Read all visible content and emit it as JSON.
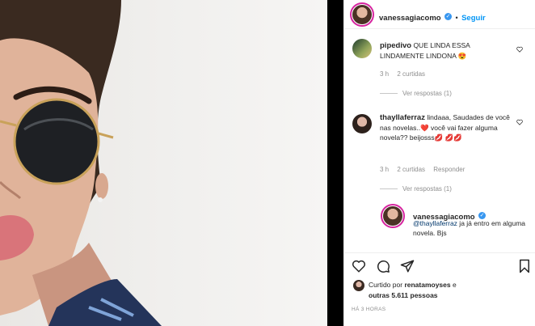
{
  "post": {
    "author": "vanessagiacomo",
    "follow_label": "Seguir",
    "dot": "•"
  },
  "comments": [
    {
      "user": "pipedivo",
      "text": "QUE LINDA ESSA LINDAMENTE LINDONA 😍",
      "time": "3 h",
      "likes": "2 curtidas",
      "replies": "Ver respostas (1)"
    },
    {
      "user": "thayllaferraz",
      "text": "lindaaa, Saudades de você nas novelas..❤️ você vai fazer alguma novela?? beijosss💋 💋💋",
      "time": "3 h",
      "likes": "2 curtidas",
      "reply_label": "Responder",
      "replies": "Ver respostas (1)"
    }
  ],
  "reply": {
    "user": "vanessagiacomo",
    "mention": "@thayllaferraz",
    "text": " ja já entro em alguma novela. Bjs"
  },
  "footer": {
    "liked_prefix": "Curtido por",
    "liked_user": "renatamoyses",
    "liked_suffix": "e",
    "others": "outras 5.611 pessoas",
    "time": "HÁ 3 HORAS"
  },
  "colors": {
    "accent": "#0095f6",
    "ring": "#d6249f",
    "lipstick": "#d9747a"
  }
}
